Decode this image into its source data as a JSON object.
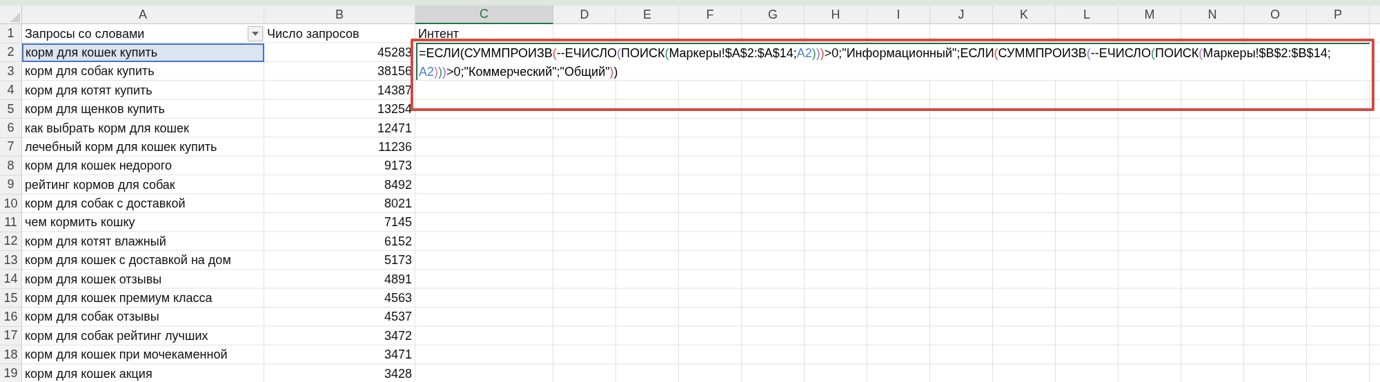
{
  "columns": [
    {
      "label": "A",
      "selected": false
    },
    {
      "label": "B",
      "selected": false
    },
    {
      "label": "C",
      "selected": true
    },
    {
      "label": "D",
      "selected": false
    },
    {
      "label": "E",
      "selected": false
    },
    {
      "label": "F",
      "selected": false
    },
    {
      "label": "G",
      "selected": false
    },
    {
      "label": "H",
      "selected": false
    },
    {
      "label": "I",
      "selected": false
    },
    {
      "label": "J",
      "selected": false
    },
    {
      "label": "K",
      "selected": false
    },
    {
      "label": "L",
      "selected": false
    },
    {
      "label": "M",
      "selected": false
    },
    {
      "label": "N",
      "selected": false
    },
    {
      "label": "O",
      "selected": false
    },
    {
      "label": "P",
      "selected": false
    }
  ],
  "header_row": {
    "number": "1",
    "cells": [
      "Запросы со словами",
      "Число запросов",
      "Интент"
    ],
    "filter_button": true
  },
  "rows": [
    {
      "number": "2",
      "query": "корм для кошек купить",
      "count": "45283",
      "referenced": true
    },
    {
      "number": "3",
      "query": "корм для собак купить",
      "count": "38156",
      "referenced": false
    },
    {
      "number": "4",
      "query": "корм для котят купить",
      "count": "14387",
      "referenced": false
    },
    {
      "number": "5",
      "query": "корм для щенков купить",
      "count": "13254",
      "referenced": false
    },
    {
      "number": "6",
      "query": "как выбрать корм для кошек",
      "count": "12471",
      "referenced": false
    },
    {
      "number": "7",
      "query": "лечебный корм для кошек купить",
      "count": "11236",
      "referenced": false
    },
    {
      "number": "8",
      "query": "корм для кошек недорого",
      "count": "9173",
      "referenced": false
    },
    {
      "number": "9",
      "query": "рейтинг кормов для собак",
      "count": "8492",
      "referenced": false
    },
    {
      "number": "10",
      "query": "корм для собак с доставкой",
      "count": "8021",
      "referenced": false
    },
    {
      "number": "11",
      "query": "чем кормить кошку",
      "count": "7145",
      "referenced": false
    },
    {
      "number": "12",
      "query": "корм для котят влажный",
      "count": "6152",
      "referenced": false
    },
    {
      "number": "13",
      "query": "корм для кошек с доставкой на дом",
      "count": "5173",
      "referenced": false
    },
    {
      "number": "14",
      "query": "корм для кошек отзывы",
      "count": "4891",
      "referenced": false
    },
    {
      "number": "15",
      "query": "корм для кошек премиум класса",
      "count": "4563",
      "referenced": false
    },
    {
      "number": "16",
      "query": "корм для собак отзывы",
      "count": "4537",
      "referenced": false
    },
    {
      "number": "17",
      "query": "корм для собак рейтинг лучших",
      "count": "3472",
      "referenced": false
    },
    {
      "number": "18",
      "query": "корм для кошек при мочекаменной",
      "count": "3471",
      "referenced": false
    },
    {
      "number": "19",
      "query": "корм для кошек акция",
      "count": "3428",
      "referenced": false
    }
  ],
  "formula": {
    "highlighted": true,
    "lines": [
      [
        {
          "text": "=ЕСЛИ(СУММПРОИЗВ",
          "color": "#000000"
        },
        {
          "text": "(",
          "color": "#d9534f"
        },
        {
          "text": "--ЕЧИСЛО",
          "color": "#000000"
        },
        {
          "text": "(",
          "color": "#9b6fc4"
        },
        {
          "text": "ПОИСК",
          "color": "#000000"
        },
        {
          "text": "(",
          "color": "#2e9a5e"
        },
        {
          "text": "Маркеры!$A$2:$A$14;",
          "color": "#000000"
        },
        {
          "text": "A2",
          "color": "#4a7fd4"
        },
        {
          "text": ")",
          "color": "#2e9a5e"
        },
        {
          "text": ")",
          "color": "#9b6fc4"
        },
        {
          "text": ")",
          "color": "#d9534f"
        },
        {
          "text": ">0;\"Информационный\";ЕСЛИ",
          "color": "#000000"
        },
        {
          "text": "(",
          "color": "#d9534f"
        },
        {
          "text": "СУММПРОИЗВ",
          "color": "#000000"
        },
        {
          "text": "(",
          "color": "#9b6fc4"
        },
        {
          "text": "--ЕЧИСЛО",
          "color": "#000000"
        },
        {
          "text": "(",
          "color": "#2e9a5e"
        },
        {
          "text": "ПОИСК",
          "color": "#000000"
        },
        {
          "text": "(",
          "color": "#c46fc4"
        },
        {
          "text": "Маркеры!$B$2:$B$14;",
          "color": "#000000"
        }
      ],
      [
        {
          "text": "A2",
          "color": "#4a7fd4"
        },
        {
          "text": ")",
          "color": "#c46fc4"
        },
        {
          "text": ")",
          "color": "#2e9a5e"
        },
        {
          "text": ")",
          "color": "#9b6fc4"
        },
        {
          "text": ">0;\"Коммерческий\";\"Общий\"",
          "color": "#000000"
        },
        {
          "text": ")",
          "color": "#d9534f"
        },
        {
          "text": ")",
          "color": "#000000"
        }
      ]
    ]
  }
}
